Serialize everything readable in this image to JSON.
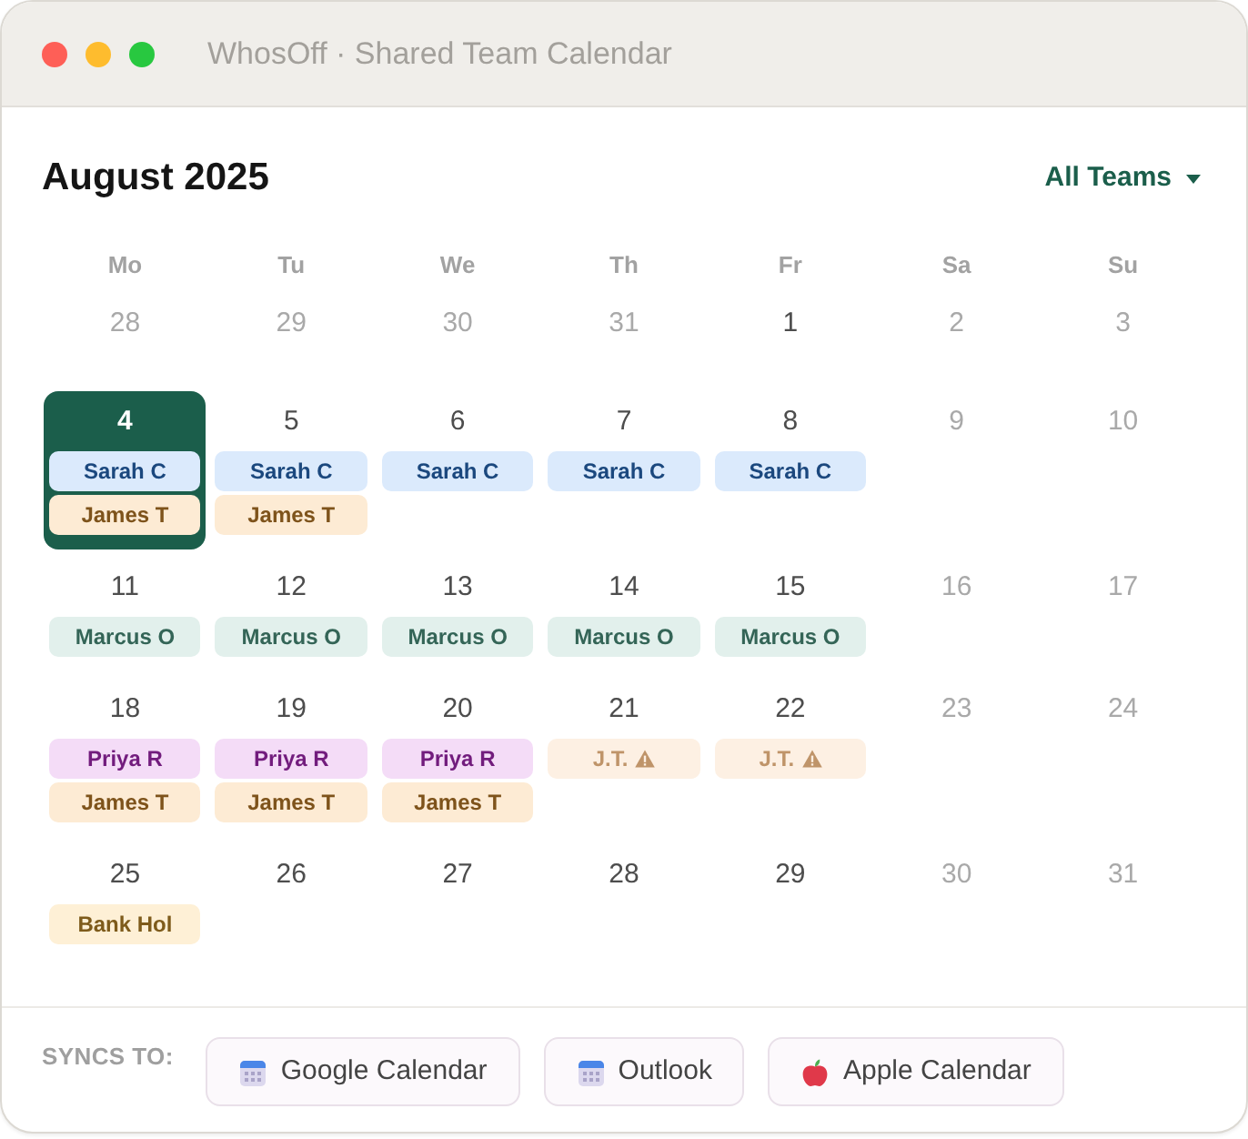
{
  "window": {
    "title": "WhosOff · Shared Team Calendar"
  },
  "header": {
    "month": "August 2025",
    "team_filter": "All Teams"
  },
  "calendar": {
    "weekdays": [
      "Mo",
      "Tu",
      "We",
      "Th",
      "Fr",
      "Sa",
      "Su"
    ],
    "weeks": [
      [
        {
          "date": "28",
          "muted": true,
          "selected": false
        },
        {
          "date": "29",
          "muted": true,
          "selected": false
        },
        {
          "date": "30",
          "muted": true,
          "selected": false
        },
        {
          "date": "31",
          "muted": true,
          "selected": false
        },
        {
          "date": "1",
          "muted": false,
          "selected": false
        },
        {
          "date": "2",
          "muted": true,
          "selected": false
        },
        {
          "date": "3",
          "muted": true,
          "selected": false
        }
      ],
      [
        {
          "date": "4",
          "muted": false,
          "selected": true,
          "entries": [
            {
              "label": "Sarah C",
              "color": "#dbeafc",
              "pending": false
            },
            {
              "label": "James T",
              "color": "#fdebd4",
              "pending": false
            }
          ]
        },
        {
          "date": "5",
          "muted": false,
          "selected": false,
          "entries": [
            {
              "label": "Sarah C",
              "color": "#dbeafc",
              "pending": false
            },
            {
              "label": "James T",
              "color": "#fdebd4",
              "pending": false
            }
          ]
        },
        {
          "date": "6",
          "muted": false,
          "selected": false,
          "entries": [
            {
              "label": "Sarah C",
              "color": "#dbeafc",
              "pending": false
            }
          ]
        },
        {
          "date": "7",
          "muted": false,
          "selected": false,
          "entries": [
            {
              "label": "Sarah C",
              "color": "#dbeafc",
              "pending": false
            }
          ]
        },
        {
          "date": "8",
          "muted": false,
          "selected": false,
          "entries": [
            {
              "label": "Sarah C",
              "color": "#dbeafc",
              "pending": false
            }
          ]
        },
        {
          "date": "9",
          "muted": true,
          "selected": false
        },
        {
          "date": "10",
          "muted": true,
          "selected": false
        }
      ],
      [
        {
          "date": "11",
          "muted": false,
          "selected": false,
          "entries": [
            {
              "label": "Marcus O",
              "color": "#e2f0ec",
              "pending": false
            }
          ]
        },
        {
          "date": "12",
          "muted": false,
          "selected": false,
          "entries": [
            {
              "label": "Marcus O",
              "color": "#e2f0ec",
              "pending": false
            }
          ]
        },
        {
          "date": "13",
          "muted": false,
          "selected": false,
          "entries": [
            {
              "label": "Marcus O",
              "color": "#e2f0ec",
              "pending": false
            }
          ]
        },
        {
          "date": "14",
          "muted": false,
          "selected": false,
          "entries": [
            {
              "label": "Marcus O",
              "color": "#e2f0ec",
              "pending": false
            }
          ]
        },
        {
          "date": "15",
          "muted": false,
          "selected": false,
          "entries": [
            {
              "label": "Marcus O",
              "color": "#e2f0ec",
              "pending": false
            }
          ]
        },
        {
          "date": "16",
          "muted": true,
          "selected": false
        },
        {
          "date": "17",
          "muted": true,
          "selected": false
        }
      ],
      [
        {
          "date": "18",
          "muted": false,
          "selected": false,
          "entries": [
            {
              "label": "Priya R",
              "color": "#f4dcf7",
              "pending": false
            },
            {
              "label": "James T",
              "color": "#fdebd4",
              "pending": false
            }
          ]
        },
        {
          "date": "19",
          "muted": false,
          "selected": false,
          "entries": [
            {
              "label": "Priya R",
              "color": "#f4dcf7",
              "pending": false
            },
            {
              "label": "James T",
              "color": "#fdebd4",
              "pending": false
            }
          ]
        },
        {
          "date": "20",
          "muted": false,
          "selected": false,
          "entries": [
            {
              "label": "Priya R",
              "color": "#f4dcf7",
              "pending": false
            },
            {
              "label": "James T",
              "color": "#fdebd4",
              "pending": false
            }
          ]
        },
        {
          "date": "21",
          "muted": false,
          "selected": false,
          "entries": [
            {
              "label": "J.T.",
              "color": "#fdf0e3",
              "pending": true
            }
          ]
        },
        {
          "date": "22",
          "muted": false,
          "selected": false,
          "entries": [
            {
              "label": "J.T.",
              "color": "#fdf0e3",
              "pending": true
            }
          ]
        },
        {
          "date": "23",
          "muted": true,
          "selected": false
        },
        {
          "date": "24",
          "muted": true,
          "selected": false
        }
      ],
      [
        {
          "date": "25",
          "muted": false,
          "selected": false,
          "entries": [
            {
              "label": "Bank Hol",
              "color": "#fef0d6",
              "pending": false
            }
          ]
        },
        {
          "date": "26",
          "muted": false,
          "selected": false
        },
        {
          "date": "27",
          "muted": false,
          "selected": false
        },
        {
          "date": "28",
          "muted": false,
          "selected": false
        },
        {
          "date": "29",
          "muted": false,
          "selected": false
        },
        {
          "date": "30",
          "muted": true,
          "selected": false
        },
        {
          "date": "31",
          "muted": true,
          "selected": false
        }
      ]
    ]
  },
  "footer": {
    "label": "SYNCS TO:",
    "services": [
      {
        "label": "Google Calendar",
        "kind": "calendar"
      },
      {
        "label": "Outlook",
        "kind": "calendar"
      },
      {
        "label": "Apple Calendar",
        "kind": "apple"
      }
    ]
  }
}
